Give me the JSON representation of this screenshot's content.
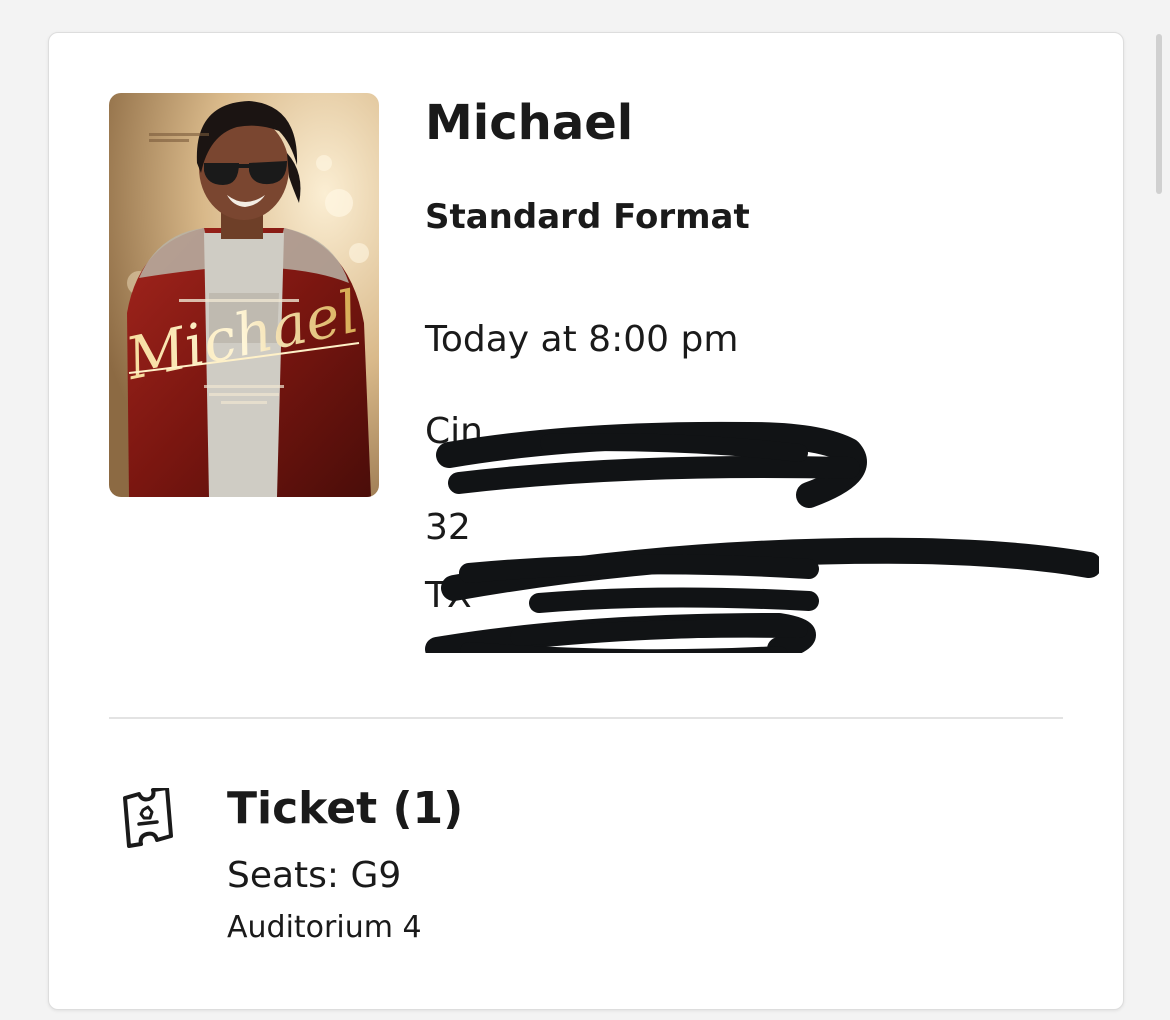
{
  "movie": {
    "title": "Michael",
    "format": "Standard Format",
    "showtime": "Today at 8:00 pm",
    "theater": "Cin",
    "address_line1": "32",
    "address_line2": "TX",
    "poster": {
      "script_title": "Michael"
    }
  },
  "ticket": {
    "title": "Ticket (1)",
    "seats": "Seats: G9",
    "auditorium": "Auditorium 4"
  },
  "colors": {
    "text": "#1a1a1a",
    "redaction": "#111315",
    "divider": "#e3e3e3"
  }
}
